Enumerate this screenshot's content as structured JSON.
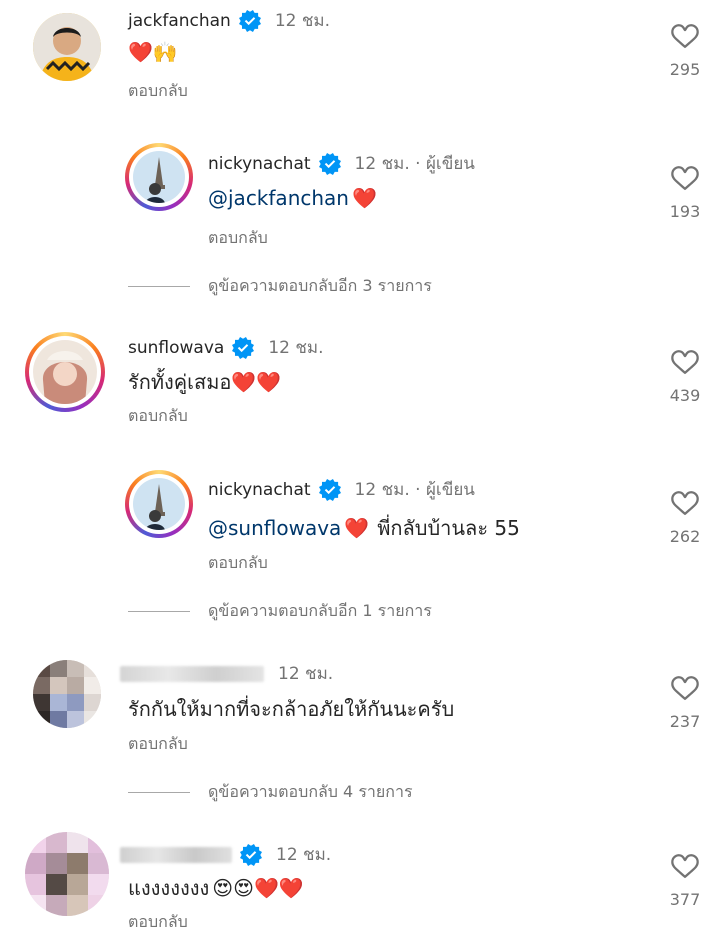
{
  "comments": [
    {
      "username": "jackfanchan",
      "verified": true,
      "time": "12 ชม.",
      "text": "",
      "emoji": "❤️🙌",
      "reply": "ตอบกลับ",
      "likes": "295"
    },
    {
      "username": "nickynachat",
      "verified": true,
      "time": "12 ชม. · ผู้เขียน",
      "mention": "@jackfanchan",
      "text": "",
      "emoji": "❤️",
      "reply": "ตอบกลับ",
      "likes": "193",
      "view_replies": "ดูข้อความตอบกลับอีก 3 รายการ"
    },
    {
      "username": "sunflowava",
      "verified": true,
      "time": "12 ชม.",
      "text": "รักทั้งคู่เสมอ",
      "emoji": "❤️❤️",
      "reply": "ตอบกลับ",
      "likes": "439"
    },
    {
      "username": "nickynachat",
      "verified": true,
      "time": "12 ชม. · ผู้เขียน",
      "mention": "@sunflowava",
      "text": "พี่กลับบ้านละ 55",
      "emoji": "❤️",
      "reply": "ตอบกลับ",
      "likes": "262",
      "view_replies": "ดูข้อความตอบกลับอีก 1 รายการ"
    },
    {
      "username": "",
      "verified": false,
      "time": "12 ชม.",
      "text": "รักกันให้มากที่จะกล้าอภัยให้กันนะครับ",
      "emoji": "",
      "reply": "ตอบกลับ",
      "likes": "237",
      "view_replies": "ดูข้อความตอบกลับ 4 รายการ"
    },
    {
      "username": "",
      "verified": true,
      "time": "12 ชม.",
      "text": "แงงงงงงง",
      "emoji": "😍😍❤️❤️",
      "reply": "ตอบกลับ",
      "likes": "377"
    }
  ],
  "colors": {
    "verified": "#0095f6",
    "secondary_text": "#737373",
    "mention": "#00376b"
  },
  "icons": {
    "like": "heart-outline-icon",
    "verified": "verified-badge-icon"
  }
}
